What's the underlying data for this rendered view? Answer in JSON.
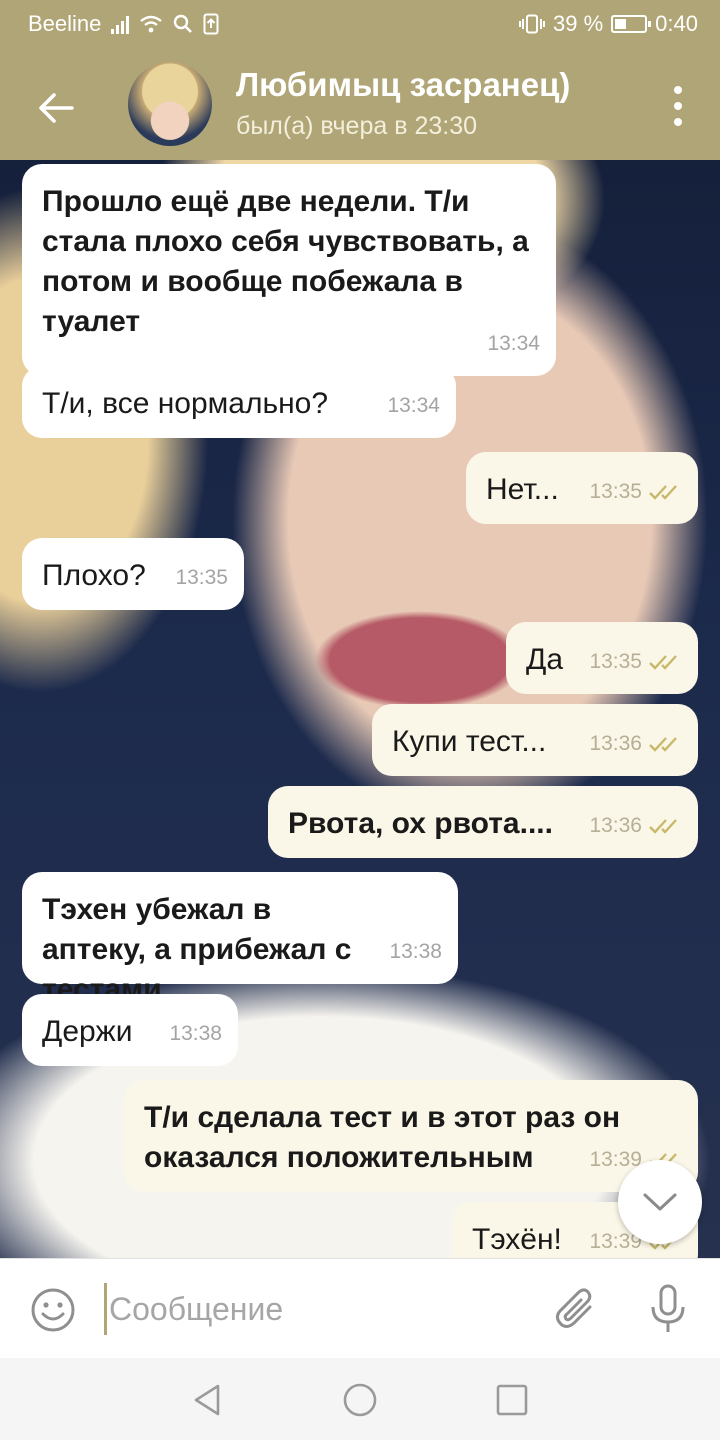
{
  "status_bar": {
    "carrier": "Beeline",
    "battery_percent": "39 %",
    "battery_level": 0.39,
    "time": "0:40"
  },
  "header": {
    "title": "Любимыц засранец)",
    "subtitle": "был(а) вчера в 23:30"
  },
  "messages": [
    {
      "direction": "in",
      "text": "Прошло ещё две недели. Т/и стала плохо себя чувствовать, а потом и вообще побежала в туалет",
      "time": "13:34"
    },
    {
      "direction": "in",
      "text": "Т/и, все нормально?",
      "time": "13:34"
    },
    {
      "direction": "out",
      "text": "Нет...",
      "time": "13:35"
    },
    {
      "direction": "in",
      "text": "Плохо?",
      "time": "13:35"
    },
    {
      "direction": "out",
      "text": "Да",
      "time": "13:35"
    },
    {
      "direction": "out",
      "text": "Купи тест...",
      "time": "13:36"
    },
    {
      "direction": "out",
      "text": "Рвота, ох рвота....",
      "time": "13:36"
    },
    {
      "direction": "in",
      "text": "Тэхен убежал в аптеку, а прибежал с тестами",
      "time": "13:38"
    },
    {
      "direction": "in",
      "text": "Держи",
      "time": "13:38"
    },
    {
      "direction": "out",
      "text": "Т/и сделала тест и в этот раз он оказался положительным",
      "time": "13:39"
    },
    {
      "direction": "out",
      "text": "Тэхён!",
      "time": "13:39"
    }
  ],
  "composer": {
    "placeholder": "Сообщение"
  },
  "icons": {
    "back": "arrow-left-icon",
    "menu": "more-vertical-icon",
    "emoji": "smile-icon",
    "attach": "paperclip-icon",
    "mic": "microphone-icon",
    "read": "double-check-icon",
    "scroll": "chevron-down-icon"
  },
  "colors": {
    "header": "#b0a576",
    "outgoing_bubble": "#fbf7e8",
    "incoming_bubble": "#ffffff",
    "read_check": "#c8b86a"
  }
}
